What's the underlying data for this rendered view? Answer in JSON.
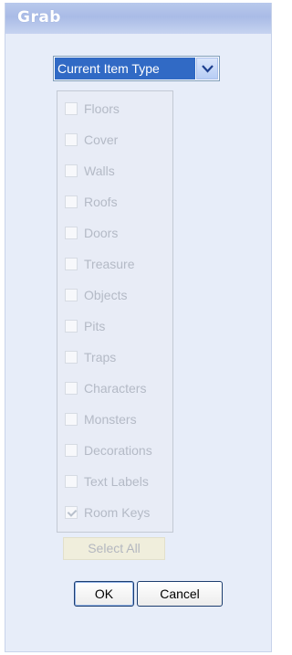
{
  "window": {
    "title": "Grab"
  },
  "item_type_select": {
    "selected": "Current Item Type"
  },
  "filters": [
    {
      "label": "Floors",
      "checked": false
    },
    {
      "label": "Cover",
      "checked": false
    },
    {
      "label": "Walls",
      "checked": false
    },
    {
      "label": "Roofs",
      "checked": false
    },
    {
      "label": "Doors",
      "checked": false
    },
    {
      "label": "Treasure",
      "checked": false
    },
    {
      "label": "Objects",
      "checked": false
    },
    {
      "label": "Pits",
      "checked": false
    },
    {
      "label": "Traps",
      "checked": false
    },
    {
      "label": "Characters",
      "checked": false
    },
    {
      "label": "Monsters",
      "checked": false
    },
    {
      "label": "Decorations",
      "checked": false
    },
    {
      "label": "Text Labels",
      "checked": false
    },
    {
      "label": "Room Keys",
      "checked": true
    }
  ],
  "actions": {
    "select_all": "Select All",
    "ok": "OK",
    "cancel": "Cancel"
  },
  "colors": {
    "title_bar": "#a9bbe6",
    "panel": "#e7edf9",
    "selection": "#316ac5"
  }
}
